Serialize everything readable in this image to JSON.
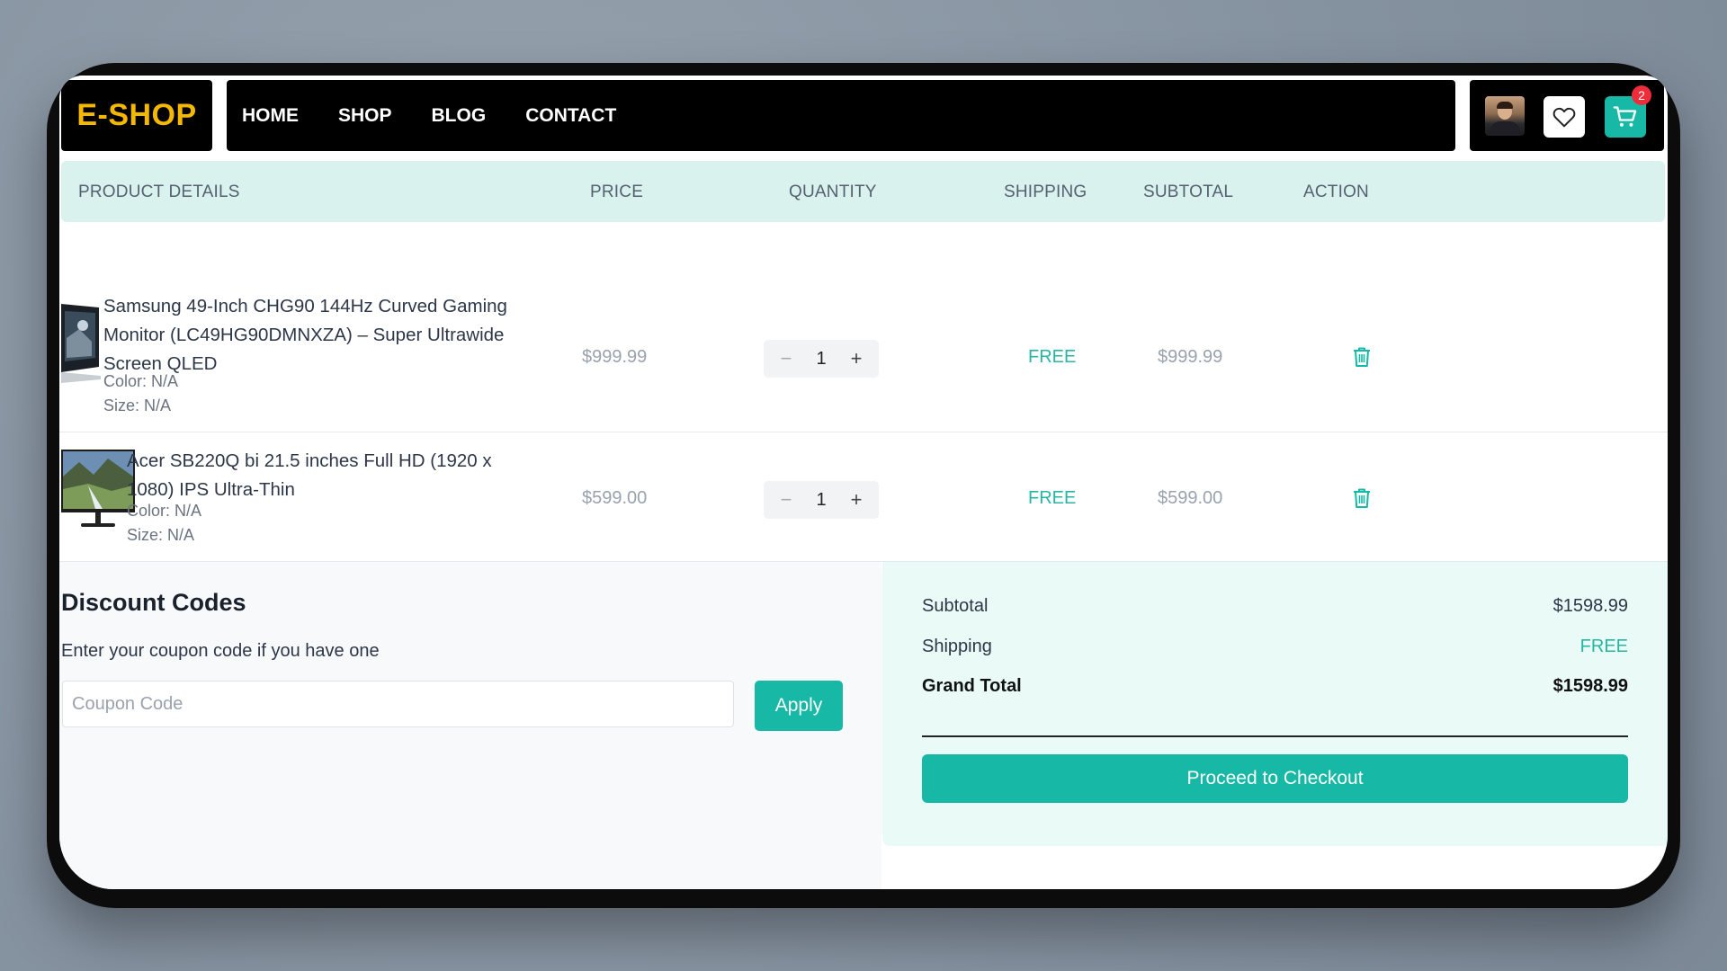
{
  "brand": {
    "logo_text": "E-SHOP",
    "accent": "#17b8a6",
    "logo_color": "#f5b800"
  },
  "nav": {
    "items": [
      {
        "label": "HOME"
      },
      {
        "label": "SHOP"
      },
      {
        "label": "BLOG"
      },
      {
        "label": "CONTACT"
      }
    ]
  },
  "header_icons": {
    "avatar": "user-avatar",
    "wishlist": "heart-icon",
    "cart": "cart-icon",
    "cart_count": "2"
  },
  "table": {
    "headers": [
      "PRODUCT DETAILS",
      "PRICE",
      "QUANTITY",
      "SHIPPING",
      "SUBTOTAL",
      "ACTION"
    ],
    "rows": [
      {
        "name_lines": [
          "Samsung 49-Inch CHG90 144Hz Curved Gaming",
          "Monitor (LC49HG90DMNXZA) – Super Ultrawide",
          "Screen QLED"
        ],
        "color": "Color: N/A",
        "size": "Size: N/A",
        "price": "$999.99",
        "quantity": "1",
        "shipping": "FREE",
        "subtotal": "$999.99",
        "action_icon": "trash-icon"
      },
      {
        "name_lines": [
          "Acer SB220Q bi 21.5 inches Full HD (1920 x",
          "1080) IPS Ultra-Thin"
        ],
        "color": "Color: N/A",
        "size": "Size: N/A",
        "price": "$599.00",
        "quantity": "1",
        "shipping": "FREE",
        "subtotal": "$599.00",
        "action_icon": "trash-icon"
      }
    ]
  },
  "discount": {
    "title": "Discount Codes",
    "subtitle": "Enter your coupon code if you have one",
    "coupon_placeholder": "Coupon Code",
    "coupon_value": "",
    "apply_label": "Apply"
  },
  "summary": {
    "subtotal_label": "Subtotal",
    "subtotal_value": "$1598.99",
    "shipping_label": "Shipping",
    "shipping_value": "FREE",
    "grand_total_label": "Grand Total",
    "grand_total_value": "$1598.99",
    "checkout_label": "Proceed to Checkout"
  }
}
